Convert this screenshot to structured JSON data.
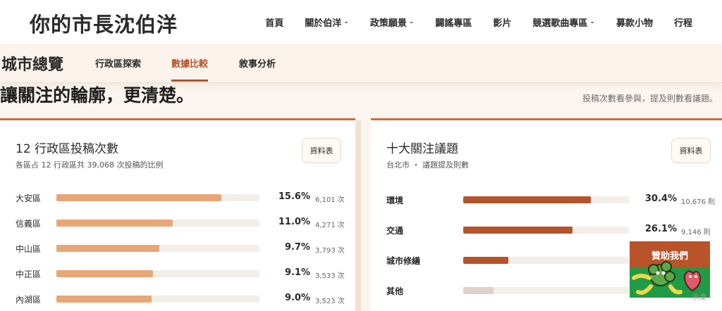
{
  "brand": "你的市長沈伯洋",
  "nav": [
    {
      "label": "首頁",
      "dropdown": false
    },
    {
      "label": "關於伯洋",
      "dropdown": true
    },
    {
      "label": "政策願景",
      "dropdown": true
    },
    {
      "label": "闢謠專區",
      "dropdown": false
    },
    {
      "label": "影片",
      "dropdown": false
    },
    {
      "label": "競選歌曲專區",
      "dropdown": true
    },
    {
      "label": "募款小物",
      "dropdown": false
    },
    {
      "label": "行程",
      "dropdown": false
    }
  ],
  "subnav": {
    "title": "城市總覽",
    "tabs": [
      "行政區探索",
      "數據比較",
      "敘事分析"
    ],
    "active": 1
  },
  "headline": "讓關注的輪廓，更清楚。",
  "hint": "投稿次數看參與，提及則數看議題。",
  "left_card": {
    "title": "12 行政區投稿次數",
    "subtitle": "各區占 12 行政區共 39,068 次投稿的比例",
    "button": "資料表",
    "rows": [
      {
        "label": "大安區",
        "pct": "15.6%",
        "count": "6,101 次",
        "value": 15.6
      },
      {
        "label": "信義區",
        "pct": "11.0%",
        "count": "4,271 次",
        "value": 11.0
      },
      {
        "label": "中山區",
        "pct": "9.7%",
        "count": "3,793 次",
        "value": 9.7
      },
      {
        "label": "中正區",
        "pct": "9.1%",
        "count": "3,533 次",
        "value": 9.1
      },
      {
        "label": "內湖區",
        "pct": "9.0%",
        "count": "3,523 次",
        "value": 9.0
      }
    ],
    "scale_max": 19.2
  },
  "right_card": {
    "title": "十大關注議題",
    "subtitle": "台北市 ・ 議題提及則數",
    "button": "資料表",
    "rows": [
      {
        "label": "環境",
        "pct": "30.4%",
        "count": "10,676 則",
        "value": 30.4,
        "gray": false
      },
      {
        "label": "交通",
        "pct": "26.1%",
        "count": "9,146 則",
        "value": 26.1,
        "gray": false
      },
      {
        "label": "城市修繕",
        "pct": "",
        "count": "",
        "value": 10.8,
        "gray": false
      },
      {
        "label": "其他",
        "pct": "",
        "count": "",
        "value": 7.3,
        "gray": true
      }
    ],
    "scale_max": 39.5
  },
  "donate": {
    "label": "贊助我們"
  },
  "watermark": "示桌",
  "colors": {
    "accent": "#b4542a",
    "bar_light": "#e8a676",
    "green": "#1f9b45"
  }
}
